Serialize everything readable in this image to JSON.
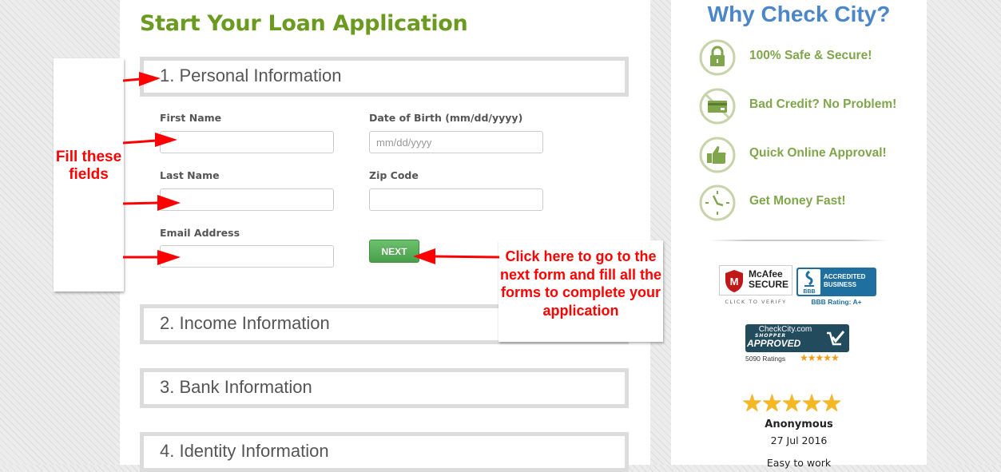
{
  "form": {
    "title": "Start Your Loan Application",
    "sections": [
      {
        "label": "1. Personal Information"
      },
      {
        "label": "2. Income Information"
      },
      {
        "label": "3. Bank Information"
      },
      {
        "label": "4. Identity Information"
      }
    ],
    "fields": {
      "first_name": {
        "label": "First Name",
        "value": "",
        "placeholder": ""
      },
      "dob": {
        "label": "Date of Birth (mm/dd/yyyy)",
        "value": "",
        "placeholder": "mm/dd/yyyy"
      },
      "last_name": {
        "label": "Last Name",
        "value": "",
        "placeholder": ""
      },
      "zip": {
        "label": "Zip Code",
        "value": "",
        "placeholder": ""
      },
      "email": {
        "label": "Email Address",
        "value": "",
        "placeholder": ""
      }
    },
    "next_label": "NEXT"
  },
  "annotations": {
    "fill_fields": "Fill these fields",
    "click_next": "Click here to go to the next form and fill all the forms to complete your application",
    "color": "#ff0000"
  },
  "sidebar": {
    "title": "Why Check City?",
    "features": [
      {
        "icon": "lock-icon",
        "label": "100% Safe & Secure!"
      },
      {
        "icon": "credit-card-icon",
        "label": "Bad Credit? No Problem!"
      },
      {
        "icon": "thumbs-up-icon",
        "label": "Quick Online Approval!"
      },
      {
        "icon": "clock-icon",
        "label": "Get Money Fast!"
      }
    ],
    "badges": {
      "mcafee_line1": "McAfee",
      "mcafee_line2": "SECURE",
      "mcafee_verify": "CLICK TO VERIFY",
      "bbb_line1": "ACCREDITED",
      "bbb_line2": "BUSINESS",
      "bbb_logo": "BBB",
      "bbb_rating": "BBB Rating: A+",
      "shopper_site": "CheckCity.com",
      "shopper_sub": "SHOPPER",
      "shopper_main": "APPROVED",
      "shopper_count": "5090 Ratings",
      "shopper_stars": "★★★★★"
    },
    "review": {
      "stars": "★★★★★",
      "rating": 5,
      "name": "Anonymous",
      "date": "27 Jul 2016",
      "text": "Easy to work"
    }
  },
  "colors": {
    "title_green": "#6a9a1f",
    "feature_green": "#7fa64a",
    "sidebar_blue": "#4a86c8",
    "next_green": "#5cb85c"
  }
}
